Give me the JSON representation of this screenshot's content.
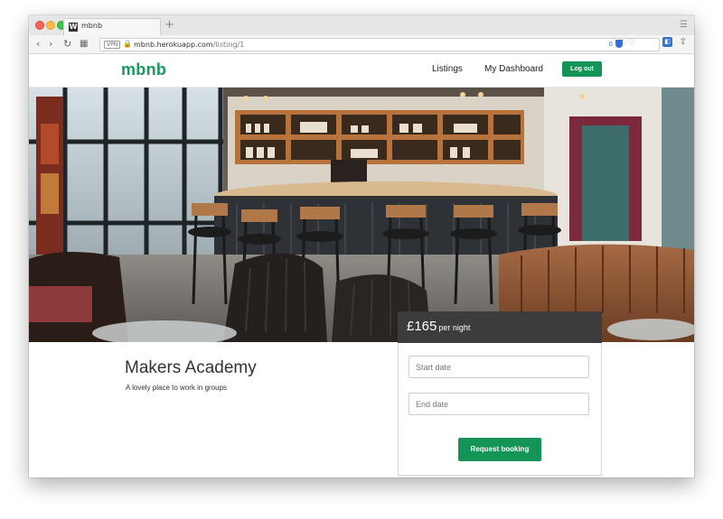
{
  "browser": {
    "tab_title": "mbnb",
    "favicon_letter": "W",
    "new_tab": "+",
    "url_badge": "VPN",
    "url_host": "mbnb.herokuapp.com",
    "url_path": "/listing/1",
    "badge_count": "0"
  },
  "site": {
    "logo": "mbnb",
    "nav": {
      "listings": "Listings",
      "dashboard": "My Dashboard",
      "logout": "Log out"
    }
  },
  "listing": {
    "title": "Makers Academy",
    "description": "A lovely place to work in groups",
    "price": "£165",
    "price_unit": "per night"
  },
  "booking": {
    "start_placeholder": "Start date",
    "end_placeholder": "End date",
    "button": "Request booking"
  },
  "colors": {
    "brand": "#179b5d",
    "button": "#149457",
    "price_bar": "#3c3c3c"
  }
}
